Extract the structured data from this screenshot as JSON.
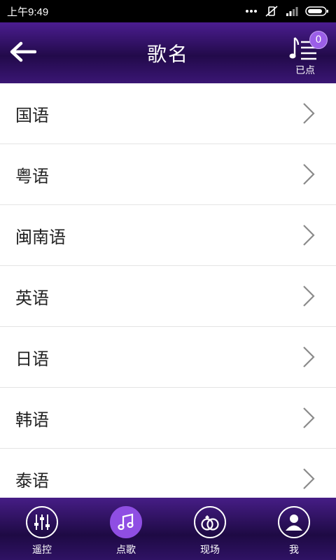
{
  "status_bar": {
    "time": "上午9:49",
    "icons": [
      "more-dots-icon",
      "mute-icon",
      "signal-icon",
      "battery-icon"
    ]
  },
  "header": {
    "title": "歌名",
    "back_icon": "arrow-left-icon",
    "playlist": {
      "label": "已点",
      "badge_count": "0",
      "icon": "music-list-icon"
    }
  },
  "categories": [
    {
      "label": "国语"
    },
    {
      "label": "粤语"
    },
    {
      "label": "闽南语"
    },
    {
      "label": "英语"
    },
    {
      "label": "日语"
    },
    {
      "label": "韩语"
    },
    {
      "label": "泰语"
    }
  ],
  "bottom_nav": {
    "items": [
      {
        "label": "遥控",
        "icon": "sliders-icon",
        "active": false
      },
      {
        "label": "点歌",
        "icon": "music-note-icon",
        "active": true
      },
      {
        "label": "现场",
        "icon": "rings-icon",
        "active": false
      },
      {
        "label": "我",
        "icon": "user-icon",
        "active": false
      }
    ]
  },
  "colors": {
    "header_purple": "#4b1d90",
    "accent_purple": "#8f4ee3",
    "badge_purple": "#9b5ee8"
  }
}
